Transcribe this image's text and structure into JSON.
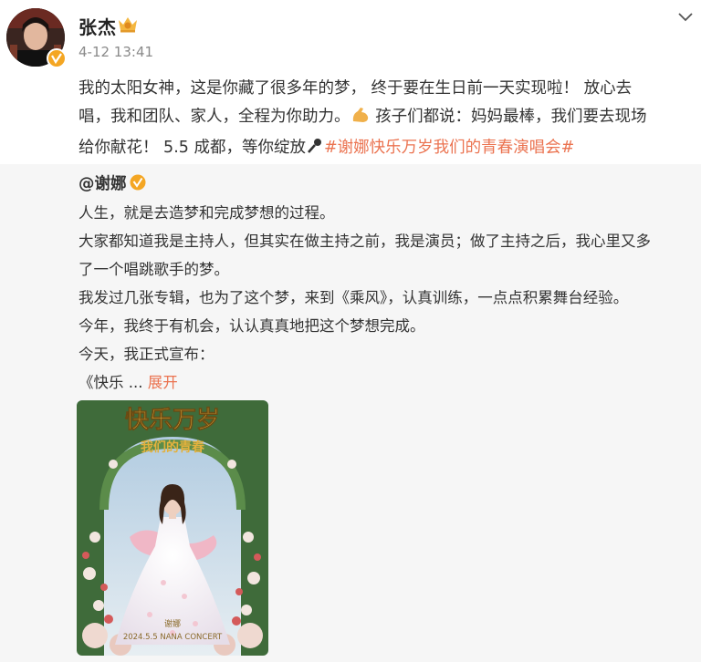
{
  "post": {
    "author": "张杰",
    "time": "4-12 13:41",
    "text": {
      "line1": "我的太阳女神，这是你藏了很多年的梦， 终于要在生日前一天实现啦！ 放心去",
      "line2a": "唱，我和团队、家人，全程为你助力。",
      "line2b": " 孩子们都说：妈妈最棒，我们要去现场",
      "line3a": "给你献花！ 5.5 成都，等你绽放",
      "hashtag": "#谢娜快乐万岁我们的青春演唱会#"
    },
    "icons": [
      "crown-icon",
      "verified-badge-icon",
      "chevron-down-icon",
      "flexed-biceps-icon",
      "microphone-icon"
    ]
  },
  "repost": {
    "author": "@谢娜",
    "lines": [
      "人生，就是去造梦和完成梦想的过程。",
      "大家都知道我是主持人，但其实在做主持之前，我是演员；做了主持之后，我心里又多",
      "了一个唱跳歌手的梦。",
      "我发过几张专辑，也为了这个梦，来到《乘风》，认真训练，一点点积累舞台经验。",
      "今年，我终于有机会，认认真真地把这个梦想完成。",
      "今天，我正式宣布："
    ],
    "truncated": "《快乐 ...",
    "expand_label": "展开"
  },
  "poster": {
    "title": "快乐万岁",
    "subtitle": "我们的青春",
    "name": "谢娜",
    "concert": "2024.5.5 NANA CONCERT",
    "colors": {
      "sky": "#c9dbe9",
      "foliage": "#3f6b3a",
      "gown": "#f3eef4",
      "gold": "#e3b13e"
    }
  },
  "colors": {
    "hashtag": "#eb7350",
    "repost_bg": "#f6f6f6",
    "time": "#8a8a8a"
  }
}
